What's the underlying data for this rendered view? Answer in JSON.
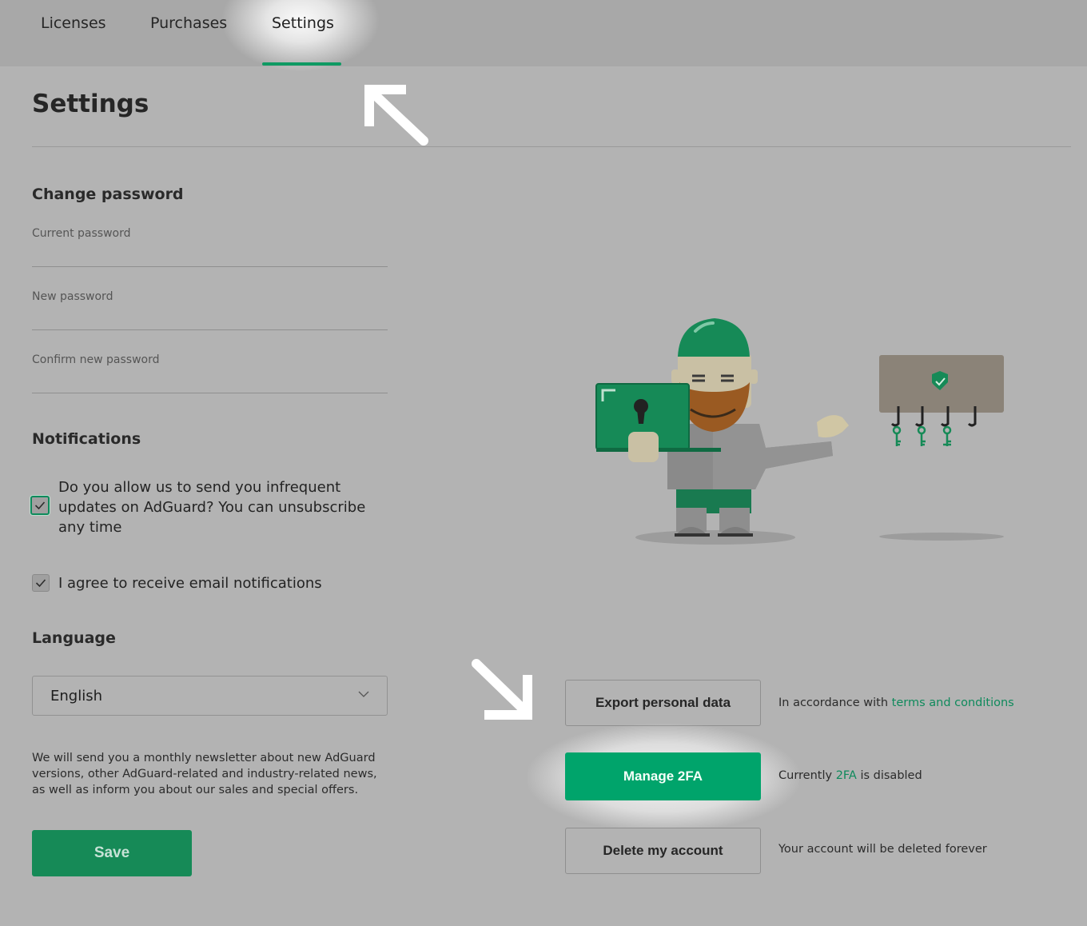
{
  "nav": {
    "tabs": [
      {
        "label": "Licenses"
      },
      {
        "label": "Purchases"
      },
      {
        "label": "Settings",
        "active": true
      }
    ]
  },
  "page": {
    "title": "Settings"
  },
  "change_password": {
    "heading": "Change password",
    "current_label": "Current password",
    "new_label": "New password",
    "confirm_label": "Confirm new password"
  },
  "notifications": {
    "heading": "Notifications",
    "updates_text": "Do you allow us to send you infrequent updates on AdGuard? You can unsubscribe any time",
    "updates_checked": true,
    "email_text": "I agree to receive email notifications",
    "email_checked": true
  },
  "language": {
    "heading": "Language",
    "selected": "English"
  },
  "newsletter_text": "We will send you a monthly newsletter about new AdGuard versions, other AdGuard-related and industry-related news, as well as inform you about our sales and special offers.",
  "save_label": "Save",
  "actions": {
    "export": {
      "label": "Export personal data",
      "note_prefix": "In accordance with ",
      "note_link": "terms and conditions"
    },
    "twofa": {
      "label": "Manage 2FA",
      "note_prefix": "Currently ",
      "note_highlight": "2FA",
      "note_suffix": " is disabled"
    },
    "delete": {
      "label": "Delete my account",
      "note": "Your account will be deleted forever"
    }
  },
  "colors": {
    "background": "#b3b3b3",
    "nav_background": "#a8a8a8",
    "accent": "#00a46b",
    "save_button": "#168a57",
    "link": "#0f8a5c"
  },
  "icons": [
    "chevron-down-icon",
    "checkmark-icon",
    "arrow-up-left-icon",
    "arrow-down-right-icon"
  ]
}
